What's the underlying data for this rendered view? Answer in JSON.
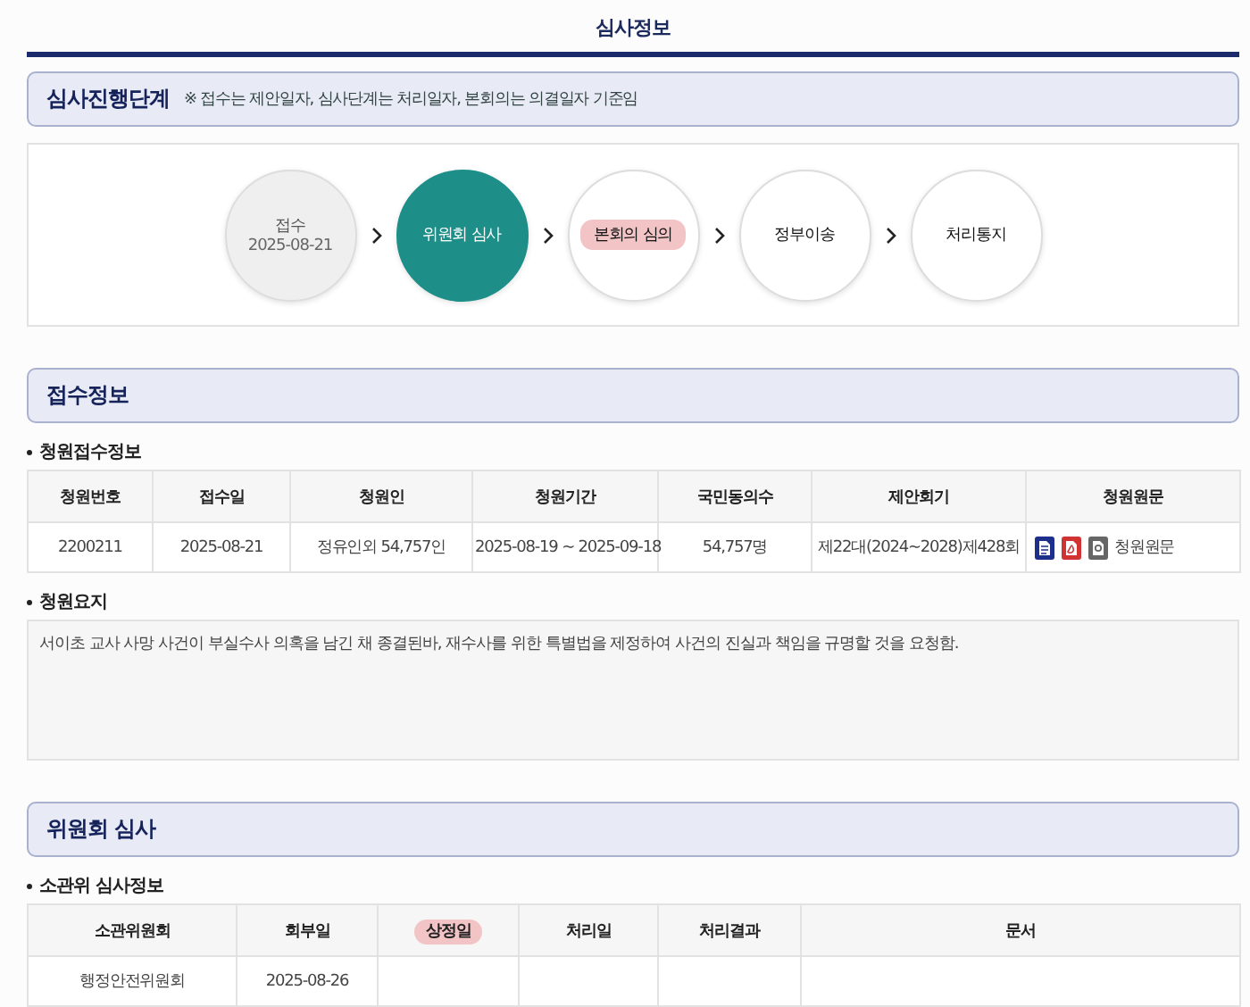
{
  "page_title": "심사정보",
  "progress": {
    "title": "심사진행단계",
    "note": "※ 접수는 제안일자, 심사단계는 처리일자, 본회의는 의결일자 기준임",
    "steps": [
      {
        "label": "접수",
        "date": "2025-08-21",
        "completed": true,
        "selected": false,
        "highlighted": false
      },
      {
        "label": "위원회 심사",
        "completed": false,
        "selected": true,
        "highlighted": false
      },
      {
        "label": "본회의 심의",
        "completed": false,
        "selected": false,
        "highlighted": true
      },
      {
        "label": "정부이송",
        "completed": false,
        "selected": false,
        "highlighted": false
      },
      {
        "label": "처리통지",
        "completed": false,
        "selected": false,
        "highlighted": false
      }
    ]
  },
  "sections": [
    {
      "title": "접수정보",
      "blocks": [
        {
          "kind": "table",
          "title": "청원접수정보",
          "columns": [
            {
              "label": "청원번호",
              "highlighted": false
            },
            {
              "label": "접수일",
              "highlighted": false
            },
            {
              "label": "청원인",
              "highlighted": false
            },
            {
              "label": "청원기간",
              "highlighted": false
            },
            {
              "label": "국민동의수",
              "highlighted": false
            },
            {
              "label": "제안회기",
              "highlighted": false
            },
            {
              "label": "청원원문",
              "highlighted": false
            }
          ],
          "rows": [
            {
              "cells": [
                "2200211",
                "2025-08-21",
                "정유인외 54,757인",
                "2025-08-19 ~ 2025-09-18",
                "54,757명",
                "제22대(2024~2028)제428회"
              ],
              "document_link": "청원원문"
            }
          ]
        },
        {
          "kind": "text",
          "title": "청원요지",
          "text": "서이초 교사 사망 사건이 부실수사 의혹을 남긴 채 종결된바, 재수사를 위한 특별법을 제정하여 사건의 진실과 책임을 규명할 것을 요청함."
        }
      ]
    },
    {
      "title": "위원회 심사",
      "blocks": [
        {
          "kind": "table",
          "title": "소관위 심사정보",
          "columns": [
            {
              "label": "소관위원회",
              "highlighted": false
            },
            {
              "label": "회부일",
              "highlighted": false
            },
            {
              "label": "상정일",
              "highlighted": true
            },
            {
              "label": "처리일",
              "highlighted": false
            },
            {
              "label": "처리결과",
              "highlighted": false
            },
            {
              "label": "문서",
              "highlighted": false
            }
          ],
          "rows": [
            {
              "cells": [
                "행정안전위원회",
                "2025-08-26",
                "",
                "",
                "",
                ""
              ]
            }
          ]
        }
      ]
    }
  ]
}
